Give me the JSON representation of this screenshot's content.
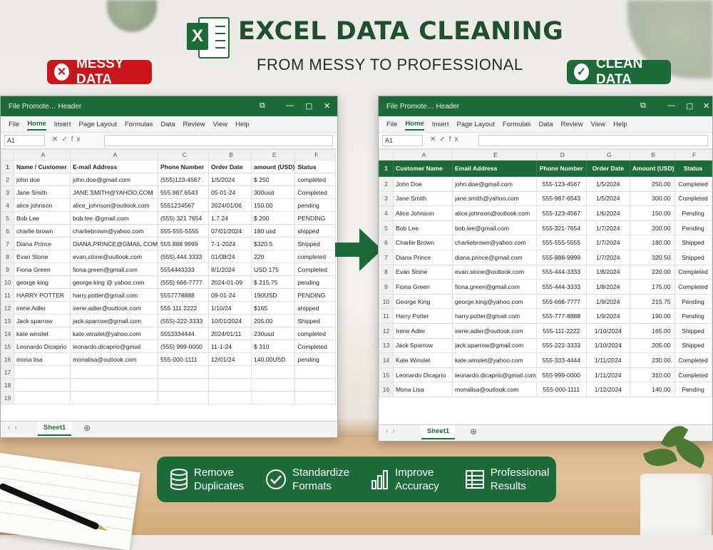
{
  "header": {
    "title": "EXCEL DATA CLEANING",
    "subtitle": "FROM MESSY TO PROFESSIONAL",
    "logo_letter": "X"
  },
  "badges": {
    "messy": "MESSY DATA",
    "clean": "CLEAN DATA",
    "messy_icon": "x-circle-icon",
    "clean_icon": "check-circle-icon"
  },
  "colors": {
    "excel_green": "#1e6b3a",
    "messy_red": "#c8161b"
  },
  "left_window": {
    "title": "File Promote… Header",
    "tabs": [
      "File",
      "Home",
      "Insert",
      "Page Layout",
      "Formulas",
      "Data",
      "Review",
      "View",
      "Help"
    ],
    "active_tab": "Home",
    "name_box": "A1",
    "fx": "fx",
    "col_letters": [
      "A",
      "A",
      "C",
      "B",
      "E",
      "F"
    ],
    "headers": [
      "Name / Customer",
      "E-mail Address",
      "Phone Number",
      "Order Date",
      "amount (USD)",
      "Status"
    ],
    "rows": [
      [
        "john doe",
        "john.doe@gmail.com",
        "(555)123-4567",
        "1/5/2024",
        "$  250",
        "completed"
      ],
      [
        "Jane Smith",
        "JANE.SMITH@YAHOO.COM",
        "555.987.6543",
        "05-01-24",
        "300usd",
        "Completed"
      ],
      [
        "  alice johnson",
        "alice_johnson@outlook.com",
        "5551234567",
        "2024/01/06",
        "150.00",
        "pending"
      ],
      [
        "Bob Lee",
        "bob.lee @gmail.com",
        "(555) 321 7654",
        "1.7.24",
        "$ 200",
        "PENDING"
      ],
      [
        "charlie brown",
        "charliebrown@yahoo.com",
        "555-555-5555",
        "07/01/2024",
        "180 usd",
        "shipped"
      ],
      [
        "Diana Prince",
        "DIANA.PRINCE@GMAIL.COM",
        "555 888 9999",
        "7-1-2024",
        "$320.5",
        "Shipped"
      ],
      [
        "Evan Stone",
        "evan.stone@outlook.com",
        "(555).444.3333",
        "01/08/24",
        "220",
        "completed"
      ],
      [
        "Fiona  Green",
        "fiona.green@gmail.com",
        "5554443333",
        "8/1/2024",
        "USD 175",
        "Completed"
      ],
      [
        "  george king",
        "george.king @ yahoo.com",
        "(555) 666-7777",
        "2024-01-09",
        "$  215.75",
        "pending"
      ],
      [
        "HARRY POTTER",
        "harry.potter@gmail.com",
        "5557778888",
        "09-01-24",
        "190USD",
        "PENDING"
      ],
      [
        "irene Adler",
        "irene.adler@outlook.com",
        "555 111 2222",
        "1/10/24",
        "$165",
        "shipped"
      ],
      [
        "Jack  sparrow",
        "jack.sparrow@gmail.com",
        "(555)-222-3333",
        "10/01/2024",
        "205.00",
        "Shipped"
      ],
      [
        "  kate winslet",
        "kate.winslet@yahoo.com",
        "5553334444",
        "2024/01/11",
        "230usd",
        "completed"
      ],
      [
        "Leonardo Dicaprio",
        "leonardo.dicaprio@gmail",
        "(555) 999-0000",
        "11-1-24",
        "$  310",
        "Completed"
      ],
      [
        "mona lisa",
        "monalisa@outlook.com",
        "555-000-1111",
        "12/01/24",
        "140.00USD",
        "pending"
      ]
    ],
    "row_numbers": [
      "1",
      "2",
      "3",
      "4",
      "5",
      "6",
      "7",
      "8",
      "9",
      "10",
      "11",
      "12",
      "13",
      "14",
      "15",
      "16",
      "17",
      "18",
      "19"
    ],
    "sheet_name": "Sheet1"
  },
  "right_window": {
    "title": "File Promote… Header",
    "tabs": [
      "File",
      "Home",
      "Insert",
      "Page Layout",
      "Formulas",
      "Data",
      "Review",
      "View",
      "Help"
    ],
    "active_tab": "Home",
    "name_box": "A1",
    "fx": "fx",
    "col_letters": [
      "A",
      "E",
      "D",
      "G",
      "B",
      "F"
    ],
    "headers": [
      "Customer Name",
      "Email Address",
      "Phone Number",
      "Order Date",
      "Amount (USD)",
      "Status"
    ],
    "rows": [
      [
        "John Doe",
        "john.doe@gmail.com",
        "555-123-4567",
        "1/5/2024",
        "250.00",
        "Completed"
      ],
      [
        "Jane Smith",
        "jane.smith@yahoo.com",
        "555-987-6543",
        "1/5/2024",
        "300.00",
        "Completed"
      ],
      [
        "Alice Johnson",
        "alice.johnson@outlook.com",
        "555-123-4567",
        "1/6/2024",
        "150.00",
        "Pending"
      ],
      [
        "Bob Lee",
        "bob.lee@gmail.com",
        "555-321-7654",
        "1/7/2024",
        "200.00",
        "Pending"
      ],
      [
        "Charlie Brown",
        "charliebrown@yahoo.com",
        "555-555-5555",
        "1/7/2024",
        "180.00",
        "Shipped"
      ],
      [
        "Diana Prince",
        "diana.prince@gmail.com",
        "555-888-9999",
        "1/7/2024",
        "320.50",
        "Shipped"
      ],
      [
        "Evan Stone",
        "evan.stone@outlook.com",
        "555-444-3333",
        "1/8/2024",
        "220.00",
        "Completed"
      ],
      [
        "Fiona Green",
        "fiona.green@gmail.com",
        "555-444-3333",
        "1/8/2024",
        "175.00",
        "Completed"
      ],
      [
        "George King",
        "george.king@yahoo.com",
        "555-666-7777",
        "1/9/2024",
        "215.75",
        "Pending"
      ],
      [
        "Harry Potter",
        "harry.potter@gmail.com",
        "555-777-8888",
        "1/9/2024",
        "190.00",
        "Pending"
      ],
      [
        "Irene Adler",
        "irene.adler@outlook.com",
        "555-111-2222",
        "1/10/2024",
        "165.00",
        "Shipped"
      ],
      [
        "Jack Sparrow",
        "jack.sparrow@gmail.com",
        "555-222-3333",
        "1/10/2024",
        "205.00",
        "Shipped"
      ],
      [
        "Kate Winslet",
        "kate.winslet@yahoo.com",
        "555-333-4444",
        "1/11/2024",
        "230.00",
        "Completed"
      ],
      [
        "Leonardo Dicaprio",
        "leonardo.dicaprio@gmail.com",
        "555-999-0000",
        "1/11/2024",
        "310.00",
        "Completed"
      ],
      [
        "Mona Lisa",
        "monalisa@outlook.com",
        "555-000-1111",
        "1/12/2024",
        "140.00",
        "Pending"
      ]
    ],
    "row_numbers": [
      "1",
      "2",
      "3",
      "4",
      "5",
      "6",
      "7",
      "8",
      "9",
      "10",
      "11",
      "12",
      "13",
      "14",
      "15",
      "16"
    ],
    "sheet_name": "Sheet1"
  },
  "features": [
    {
      "icon": "database-icon",
      "line1": "Remove",
      "line2": "Duplicates"
    },
    {
      "icon": "check-circle-icon",
      "line1": "Standardize",
      "line2": "Formats"
    },
    {
      "icon": "bar-chart-icon",
      "line1": "Improve",
      "line2": "Accuracy"
    },
    {
      "icon": "table-icon",
      "line1": "Professional",
      "line2": "Results"
    }
  ]
}
